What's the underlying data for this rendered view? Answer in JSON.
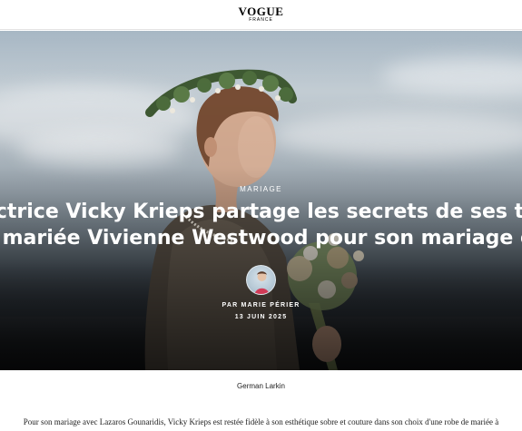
{
  "header": {
    "logo_main": "VOGUE",
    "logo_sub": "FRANCE"
  },
  "hero": {
    "category": "MARIAGE",
    "headline_line1": "actrice Vicky Krieps partage les secrets de ses trois rob",
    "headline_line2": "e mariée Vivienne Westwood pour son mariage en Grè",
    "author": "PAR MARIE PÉRIER",
    "date": "13 JUIN 2025"
  },
  "caption": "German Larkin",
  "body_text": "Pour son mariage avec Lazaros Gounaridis, Vicky Krieps est restée fidèle à son esthétique sobre et couture dans son choix d'une robe de mariée à"
}
